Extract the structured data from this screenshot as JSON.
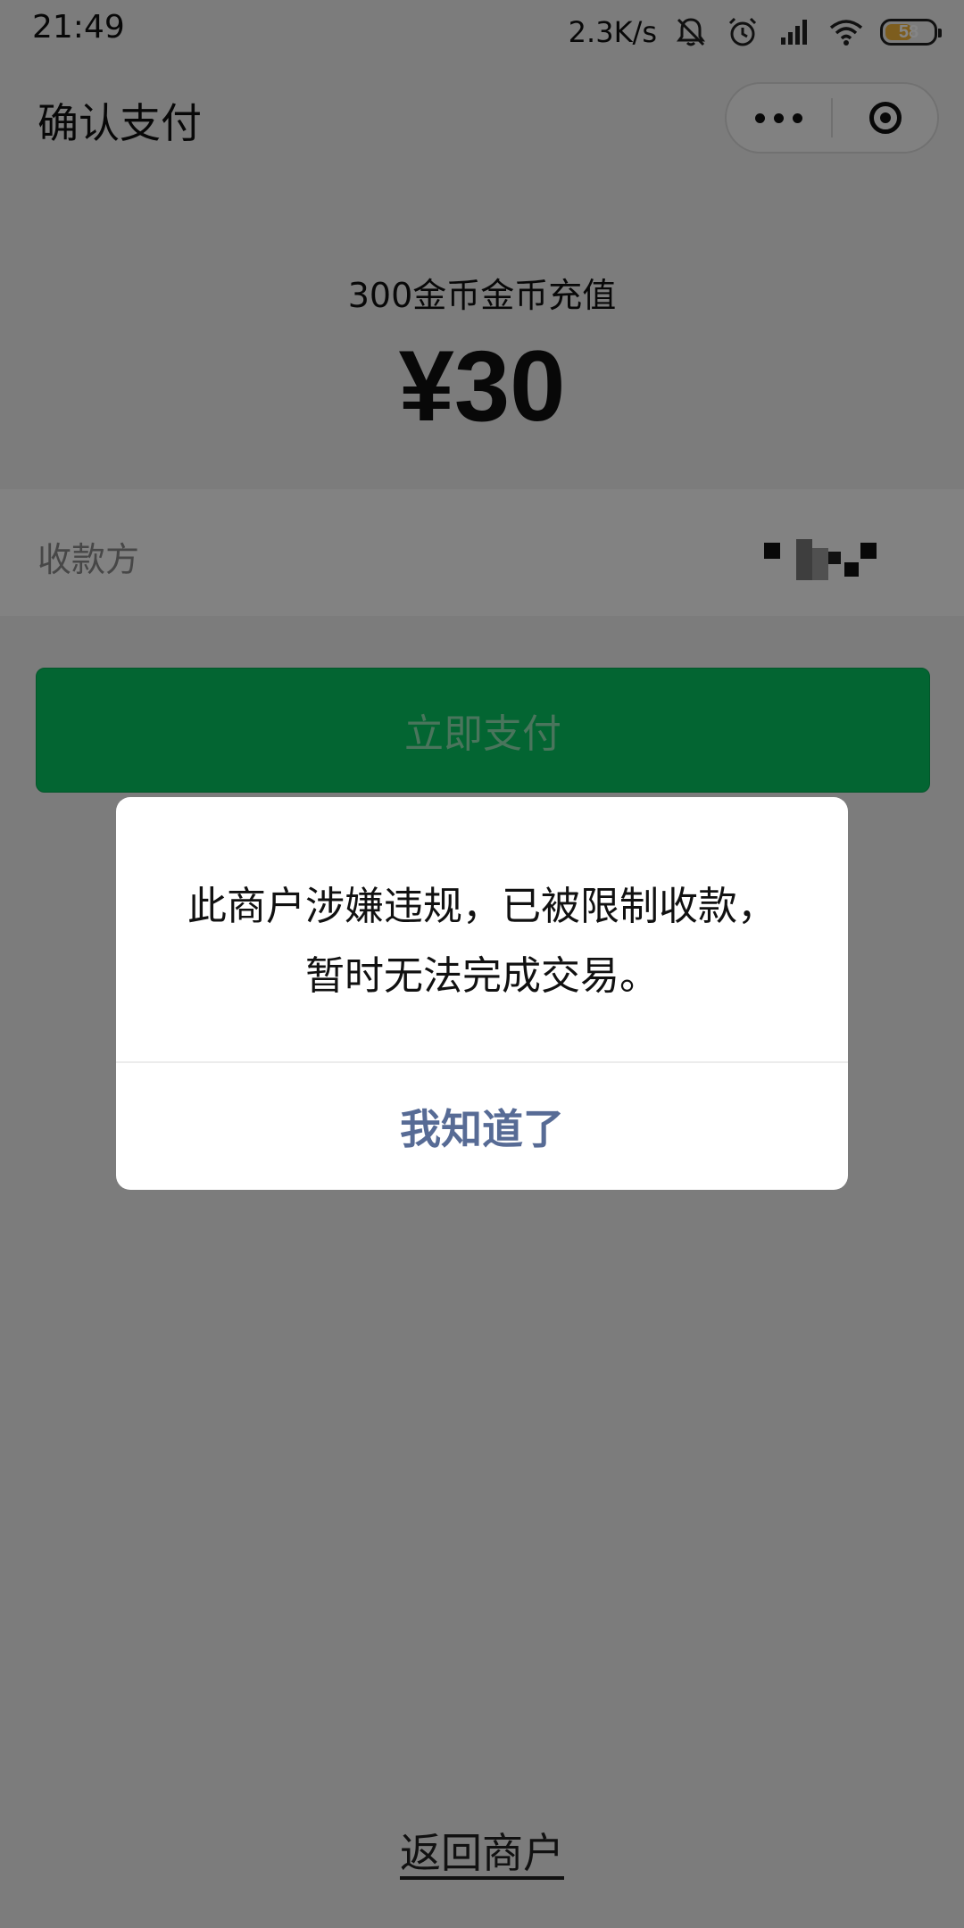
{
  "status_bar": {
    "time": "21:49",
    "network_speed": "2.3K/s",
    "battery_level": "58",
    "battery_fraction": 0.58,
    "battery_color": "#f0b33a",
    "icons": [
      "mute-bell-icon",
      "alarm-clock-icon",
      "signal-icon",
      "wifi-icon",
      "battery-icon"
    ]
  },
  "nav": {
    "title": "确认支付",
    "more_icon": "more-dots-icon",
    "close_icon": "target-close-icon"
  },
  "order": {
    "product_name": "300金币金币充值",
    "amount": "¥30"
  },
  "payee": {
    "label": "收款方",
    "name_redacted": true
  },
  "pay_button": {
    "label": "立即支付",
    "color": "#07c160"
  },
  "back_link": {
    "label": "返回商户"
  },
  "dialog": {
    "message": "此商户涉嫌违规，已被限制收款，暂时无法完成交易。",
    "confirm_label": "我知道了",
    "confirm_color": "#576b95"
  }
}
